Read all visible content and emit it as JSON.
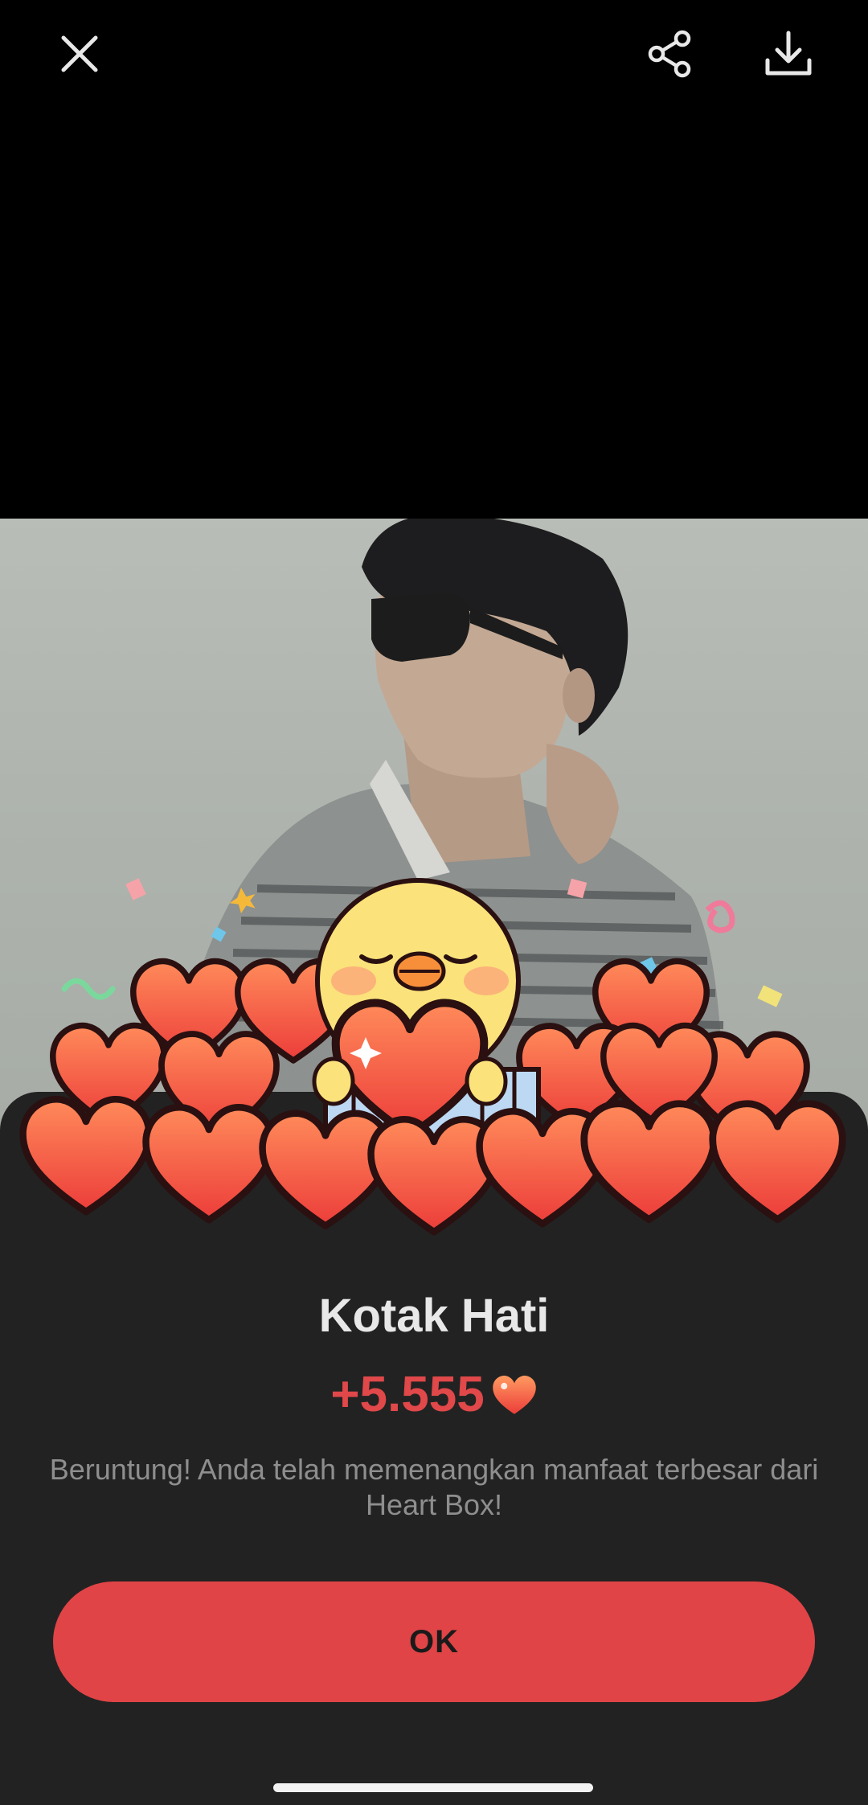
{
  "topbar": {
    "close_icon": "close-icon",
    "share_icon": "share-icon",
    "download_icon": "download-icon"
  },
  "photo": {
    "description_icon": "photo-image"
  },
  "reward": {
    "title": "Kotak Hati",
    "amount": "+5.555",
    "currency_icon": "heart-icon",
    "message": "Beruntung! Anda telah memenangkan manfaat terbesar dari Heart Box!",
    "ok_label": "OK"
  },
  "colors": {
    "accent": "#e04446",
    "amount": "#e0484a",
    "sheet_bg": "#222222",
    "background": "#000000"
  }
}
